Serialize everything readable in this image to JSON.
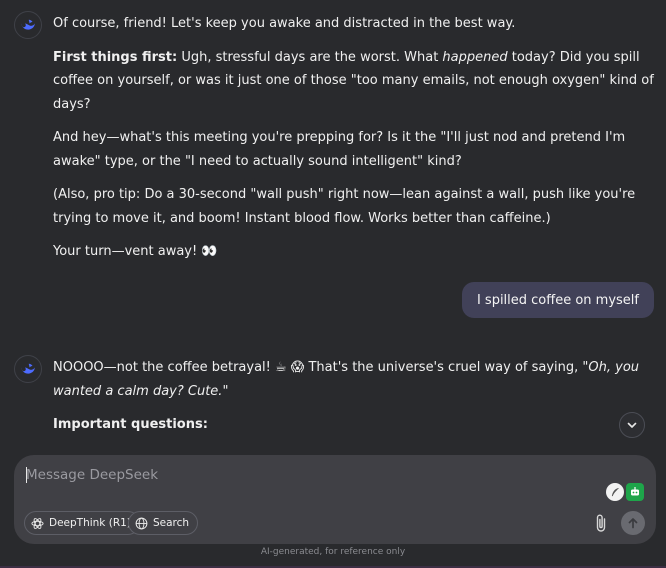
{
  "assistant_message_1": {
    "greeting": "Of course, friend! Let's keep you awake and distracted in the best way.",
    "p1_bold": "First things first:",
    "p1_a": " Ugh, stressful days are the worst. What ",
    "p1_italic": "happened",
    "p1_b": " today? Did you spill coffee on yourself, or was it just one of those \"too many emails, not enough oxygen\" kind of days?",
    "p2": "And hey—what's this meeting you're prepping for? Is it the \"I'll just nod and pretend I'm awake\" type, or the \"I need to actually sound intelligent\" kind?",
    "p3": "(Also, pro tip: Do a 30-second \"wall push\" right now—lean against a wall, push like you're trying to move it, and boom! Instant blood flow. Works better than caffeine.)",
    "p4": "Your turn—vent away! 👀"
  },
  "user_message": {
    "text": "I spilled coffee on myself"
  },
  "assistant_message_2": {
    "p1_a": "NOOOO—not the coffee betrayal! ☕ 😱 That's the universe's cruel way of saying, \"",
    "p1_italic": "Oh, you wanted a calm day? Cute.",
    "p1_b": "\"",
    "heading": "Important questions:"
  },
  "composer": {
    "placeholder": "Message DeepSeek",
    "deepthink_label": "DeepThink (R1)",
    "search_label": "Search"
  },
  "icons": {
    "assistant": "deepseek-whale-icon",
    "scroll": "chevron-down-icon",
    "deepthink": "atom-icon",
    "search": "globe-icon",
    "attach": "paperclip-icon",
    "send": "arrow-up-icon"
  },
  "colors": {
    "background": "#292a2d",
    "user_bubble": "#414158",
    "composer": "#404045",
    "brand": "#4d6bfe"
  },
  "footer": {
    "disclaimer": "AI-generated, for reference only"
  }
}
